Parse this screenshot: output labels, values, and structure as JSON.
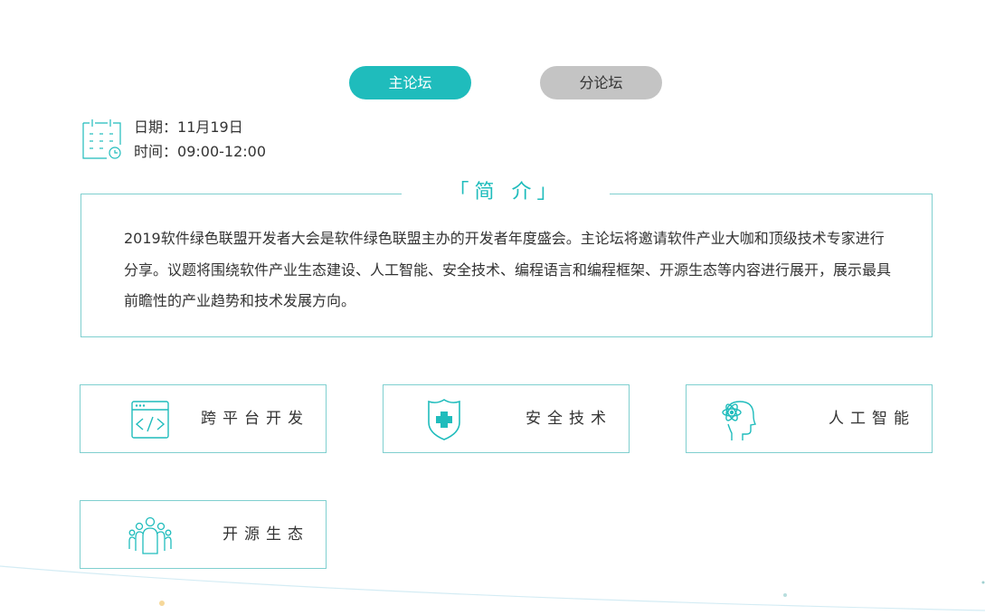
{
  "tabs": [
    {
      "label": "主论坛",
      "active": true
    },
    {
      "label": "分论坛",
      "active": false
    }
  ],
  "schedule": {
    "date_label": "日期：",
    "date_value": "11月19日",
    "time_label": "时间：",
    "time_value": "09:00-12:00"
  },
  "intro": {
    "title": "「简 介」",
    "text": "2019软件绿色联盟开发者大会是软件绿色联盟主办的开发者年度盛会。主论坛将邀请软件产业大咖和顶级技术专家进行分享。议题将围绕软件产业生态建设、人工智能、安全技术、编程语言和编程框架、开源生态等内容进行展开，展示最具前瞻性的产业趋势和技术发展方向。"
  },
  "topics": [
    {
      "label": "跨平台开发",
      "icon": "code-window-icon"
    },
    {
      "label": "安全技术",
      "icon": "shield-cross-icon"
    },
    {
      "label": "人工智能",
      "icon": "ai-head-icon"
    },
    {
      "label": "开源生态",
      "icon": "community-icon"
    }
  ],
  "colors": {
    "accent": "#1fbcbc",
    "inactive_tab": "#c4c4c4",
    "border": "#7fcfcf"
  }
}
